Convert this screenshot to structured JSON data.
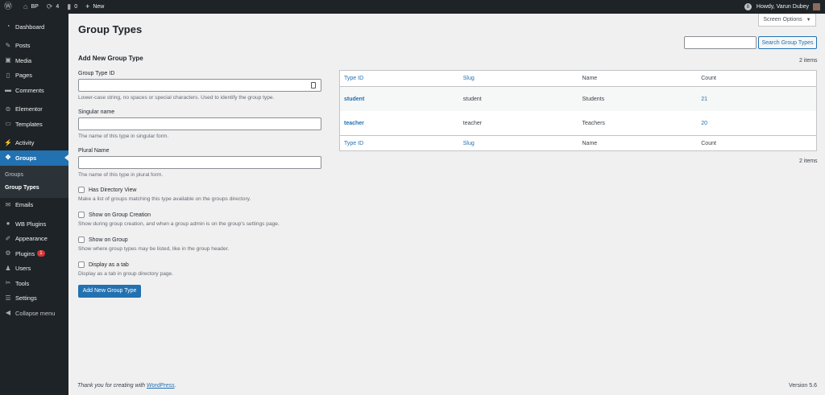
{
  "adminbar": {
    "site_name": "BP",
    "updates_count": "4",
    "comments_count": "0",
    "new_label": "New",
    "howdy": "Howdy, Varun Dubey"
  },
  "sidebar": {
    "items": [
      {
        "label": "Dashboard",
        "icon": "dashboard-icon"
      },
      {
        "label": "Posts",
        "icon": "pin-icon"
      },
      {
        "label": "Media",
        "icon": "media-icon"
      },
      {
        "label": "Pages",
        "icon": "page-icon"
      },
      {
        "label": "Comments",
        "icon": "comment-icon"
      },
      {
        "label": "Elementor",
        "icon": "elementor-icon"
      },
      {
        "label": "Templates",
        "icon": "folder-icon"
      },
      {
        "label": "Activity",
        "icon": "activity-icon"
      },
      {
        "label": "Groups",
        "icon": "groups-icon"
      },
      {
        "label": "Emails",
        "icon": "email-icon"
      },
      {
        "label": "WB Plugins",
        "icon": "bulb-icon"
      },
      {
        "label": "Appearance",
        "icon": "brush-icon"
      },
      {
        "label": "Plugins",
        "icon": "plugin-icon",
        "badge": "1"
      },
      {
        "label": "Users",
        "icon": "user-icon"
      },
      {
        "label": "Tools",
        "icon": "wrench-icon"
      },
      {
        "label": "Settings",
        "icon": "settings-icon"
      },
      {
        "label": "Collapse menu",
        "icon": "collapse-icon"
      }
    ],
    "submenu": [
      "Groups",
      "Group Types"
    ]
  },
  "screen_options": "Screen Options",
  "page_title": "Group Types",
  "search": {
    "button": "Search Group Types",
    "value": ""
  },
  "form": {
    "heading": "Add New Group Type",
    "type_id": {
      "label": "Group Type ID",
      "desc": "Lower-case string, no spaces or special characters. Used to identify the group type."
    },
    "singular": {
      "label": "Singular name",
      "desc": "The name of this type in singular form."
    },
    "plural": {
      "label": "Plural Name",
      "desc": "The name of this type in plural form."
    },
    "checkboxes": [
      {
        "label": "Has Directory View",
        "desc": "Make a list of groups matching this type available on the groups directory."
      },
      {
        "label": "Show on Group Creation",
        "desc": "Show during group creation, and when a group admin is on the group's settings page."
      },
      {
        "label": "Show on Group",
        "desc": "Show where group types may be listed, like in the group header."
      },
      {
        "label": "Display as a tab",
        "desc": "Display as a tab in group directory page."
      }
    ],
    "submit": "Add New Group Type"
  },
  "table": {
    "count_top": "2 items",
    "count_bottom": "2 items",
    "headers": [
      "Type ID",
      "Slug",
      "Name",
      "Count"
    ],
    "rows": [
      {
        "type_id": "student",
        "slug": "student",
        "name": "Students",
        "count": "21"
      },
      {
        "type_id": "teacher",
        "slug": "teacher",
        "name": "Teachers",
        "count": "20"
      }
    ]
  },
  "footer": {
    "thanks_prefix": "Thank you for creating with ",
    "thanks_link": "WordPress",
    "thanks_suffix": ".",
    "version": "Version 5.6"
  },
  "colors": {
    "accent": "#2271b1",
    "sidebar_bg": "#1d2327",
    "page_bg": "#f0f0f1",
    "badge": "#d63638"
  }
}
